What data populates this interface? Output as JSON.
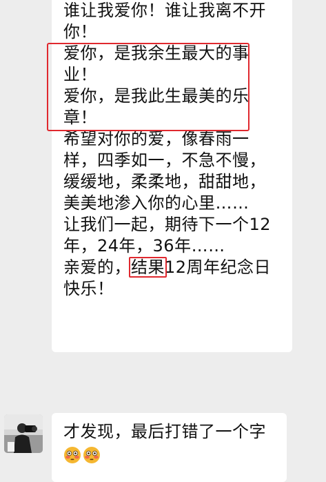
{
  "colors": {
    "background": "#ededed",
    "bubble": "#ffffff",
    "highlight": "#e0282e",
    "text": "#111111"
  },
  "message_1": {
    "lines": [
      "谁让我爱你！谁让我离不开",
      "你！",
      "爱你，是我余生最大的事",
      "业！",
      "爱你，是我此生最美的乐",
      "章！",
      "希望对你的爱，像春雨一",
      "样，四季如一，不急不慢，",
      "缓缓地，柔柔地，甜甜地，",
      "美美地渗入你的心里……",
      "让我们一起，期待下一个12",
      "年，24年，36年……"
    ],
    "last_line_prefix": "亲爱的，",
    "last_line_highlight": "结果",
    "last_line_suffix": "12周年纪念日",
    "final_line": "快乐！"
  },
  "message_2": {
    "text": "才发现，最后打错了一个字",
    "emojis": [
      "flushed-face-icon",
      "flushed-face-icon"
    ]
  },
  "avatar": {
    "icon": "photographer-avatar-icon"
  }
}
